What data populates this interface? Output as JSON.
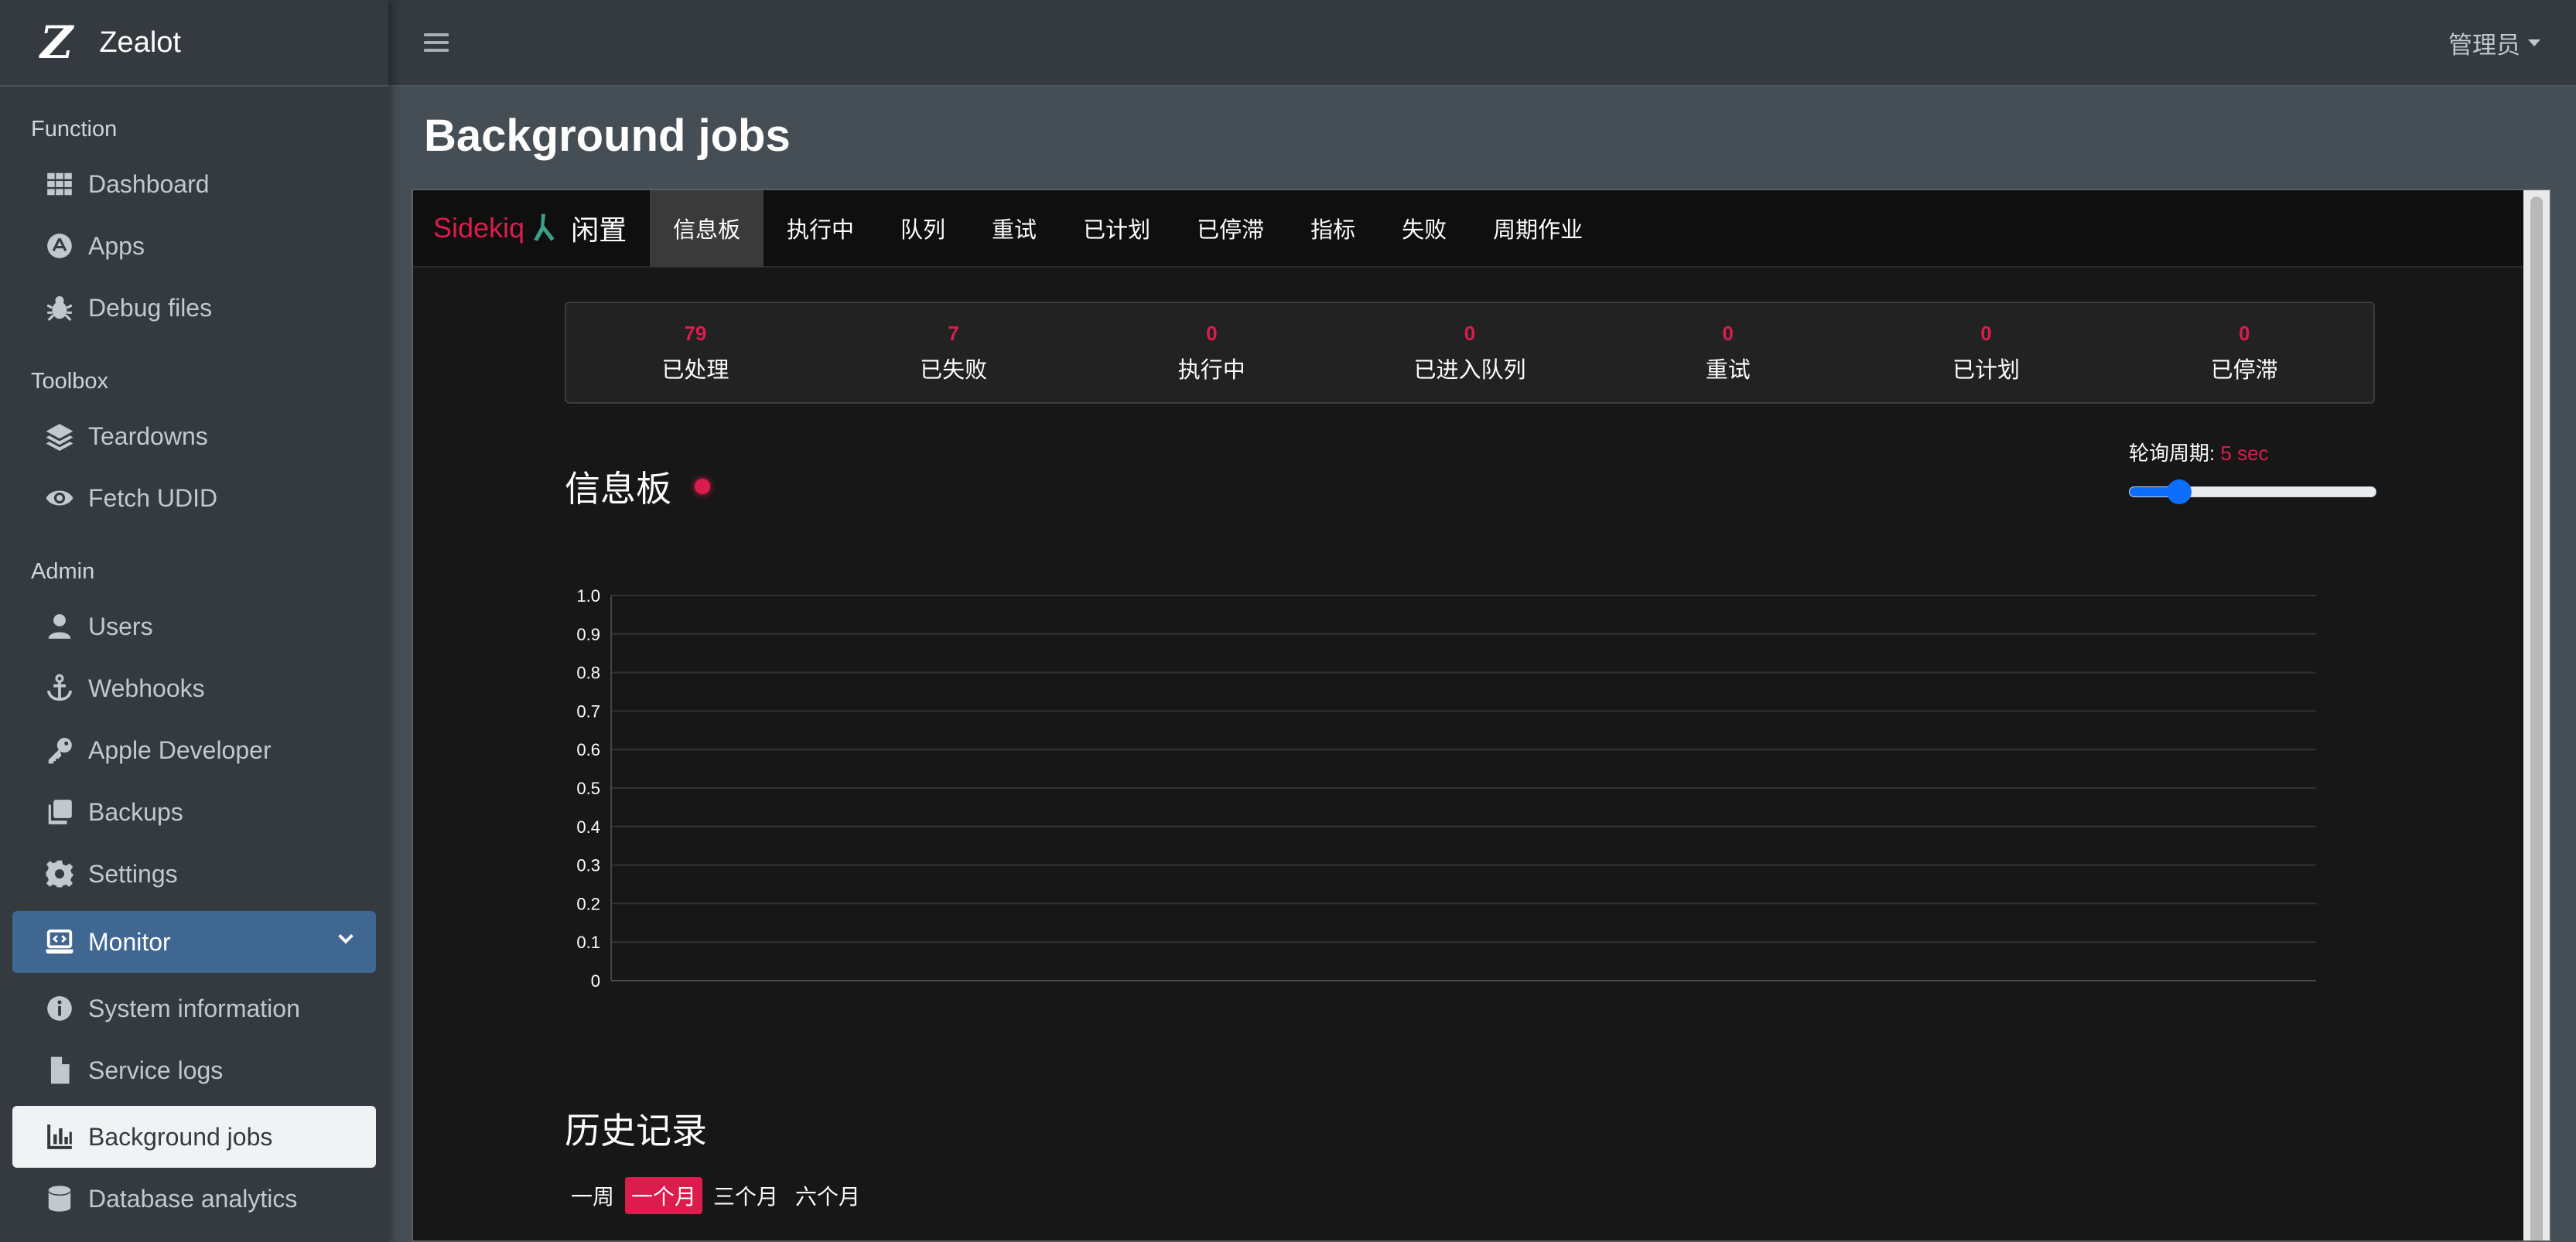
{
  "brand": {
    "logo": "Z",
    "name": "Zealot"
  },
  "topbar": {
    "user": "管理员"
  },
  "sidebar": {
    "sections": [
      {
        "header": "Function",
        "items": [
          {
            "label": "Dashboard",
            "icon": "grid-icon"
          },
          {
            "label": "Apps",
            "icon": "app-store-icon"
          },
          {
            "label": "Debug files",
            "icon": "bug-icon"
          }
        ]
      },
      {
        "header": "Toolbox",
        "items": [
          {
            "label": "Teardowns",
            "icon": "layers-icon"
          },
          {
            "label": "Fetch UDID",
            "icon": "eye-icon"
          }
        ]
      },
      {
        "header": "Admin",
        "items": [
          {
            "label": "Users",
            "icon": "user-icon"
          },
          {
            "label": "Webhooks",
            "icon": "anchor-icon"
          },
          {
            "label": "Apple Developer",
            "icon": "key-icon"
          },
          {
            "label": "Backups",
            "icon": "copy-icon"
          },
          {
            "label": "Settings",
            "icon": "gear-icon"
          }
        ]
      }
    ],
    "monitor": {
      "label": "Monitor",
      "icon": "laptop-code-icon",
      "children": [
        {
          "label": "System information",
          "icon": "info-circle-icon"
        },
        {
          "label": "Service logs",
          "icon": "file-icon"
        },
        {
          "label": "Background jobs",
          "icon": "chart-bar-icon",
          "active": true
        },
        {
          "label": "Database analytics",
          "icon": "database-icon"
        }
      ]
    }
  },
  "page": {
    "title": "Background jobs"
  },
  "sidekiq": {
    "brand": "Sidekiq",
    "status": "闲置",
    "tabs": [
      "信息板",
      "执行中",
      "队列",
      "重试",
      "已计划",
      "已停滞",
      "指标",
      "失败",
      "周期作业"
    ],
    "active_tab": 0,
    "stats": [
      {
        "value": "79",
        "label": "已处理"
      },
      {
        "value": "7",
        "label": "已失败"
      },
      {
        "value": "0",
        "label": "执行中"
      },
      {
        "value": "0",
        "label": "已进入队列"
      },
      {
        "value": "0",
        "label": "重试"
      },
      {
        "value": "0",
        "label": "已计划"
      },
      {
        "value": "0",
        "label": "已停滞"
      }
    ],
    "dashboard_title": "信息板",
    "poll_label": "轮询周期: ",
    "poll_value": "5 sec",
    "poll_fraction": 0.2,
    "history_title": "历史记录",
    "ranges": [
      "一周",
      "一个月",
      "三个月",
      "六个月"
    ],
    "active_range": 1
  },
  "chart_data": {
    "type": "line",
    "title": "",
    "xlabel": "",
    "ylabel": "",
    "ylim": [
      0,
      1.0
    ],
    "y_ticks": [
      "1.0",
      "0.9",
      "0.8",
      "0.7",
      "0.6",
      "0.5",
      "0.4",
      "0.3",
      "0.2",
      "0.1",
      "0"
    ],
    "series": [],
    "grid": true
  },
  "colors": {
    "accent": "#dc1c4d",
    "sidebar": "#343a40",
    "monitor_active": "#3f6791",
    "slider": "#0d6efd"
  }
}
